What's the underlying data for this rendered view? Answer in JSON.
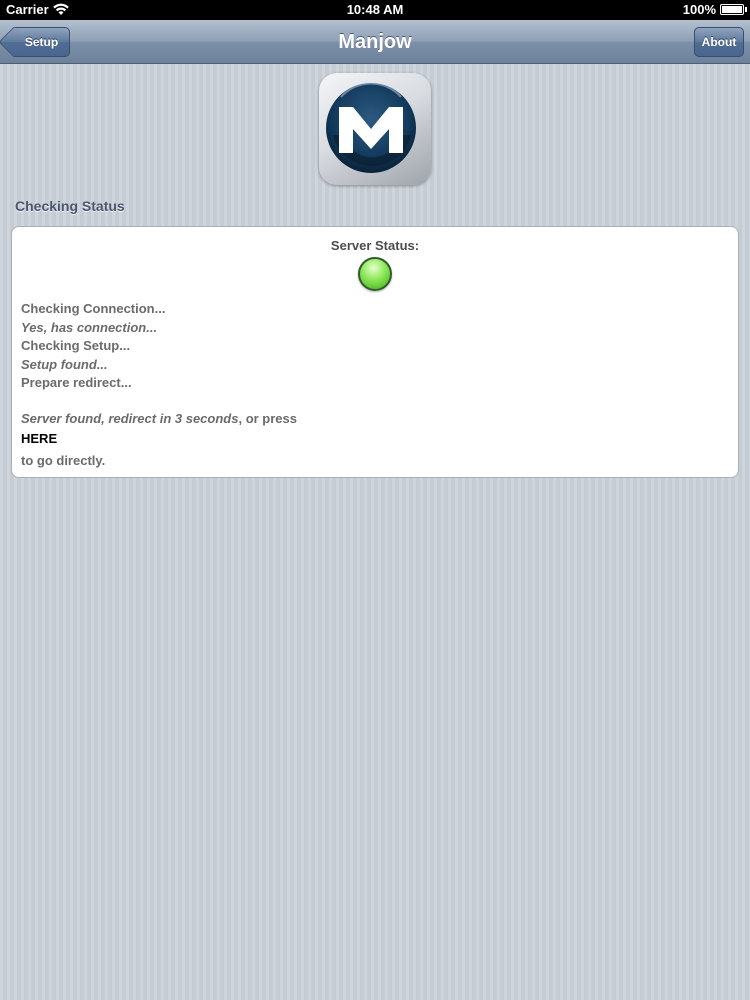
{
  "status_bar": {
    "carrier": "Carrier",
    "wifi_icon": "wifi-icon",
    "time": "10:48 AM",
    "battery": "100%",
    "battery_icon": "battery-icon"
  },
  "nav": {
    "title": "Manjow",
    "back_label": "Setup",
    "about_label": "About"
  },
  "logo": {
    "icon": "manjow-logo-icon"
  },
  "section": {
    "title": "Checking Status"
  },
  "status_card": {
    "server_status_label": "Server Status:",
    "status_light_color": "#6cd43a",
    "log": [
      "Checking Connection...",
      "Yes, has connection...",
      "Checking Setup...",
      "Setup found...",
      "Prepare redirect..."
    ],
    "redirect_message_italic": "Server found, redirect in 3 seconds",
    "redirect_message_suffix": ", or press",
    "here_link": "HERE",
    "go_directly": "to go directly."
  },
  "colors": {
    "nav_bar": "#7d90a9",
    "background": "#c5ccd4",
    "text_grey": "#6b6b6b"
  }
}
